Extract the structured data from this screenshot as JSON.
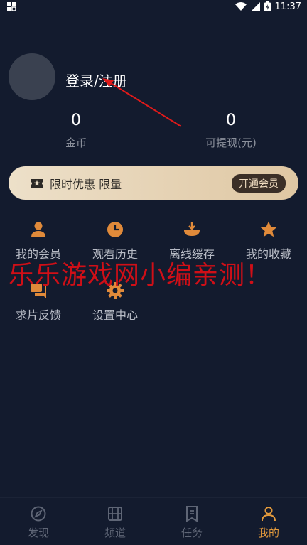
{
  "status_bar": {
    "time": "11:37"
  },
  "profile": {
    "login_text": "登录/注册"
  },
  "stats": [
    {
      "value": "0",
      "label": "金币"
    },
    {
      "value": "0",
      "label": "可提现(元)"
    }
  ],
  "vip_banner": {
    "text": "限时优惠 限量",
    "button_label": "开通会员"
  },
  "menu_items": [
    {
      "label": "我的会员",
      "icon": "user-icon"
    },
    {
      "label": "观看历史",
      "icon": "clock-icon"
    },
    {
      "label": "离线缓存",
      "icon": "download-icon"
    },
    {
      "label": "我的收藏",
      "icon": "star-icon"
    },
    {
      "label": "求片反馈",
      "icon": "chat-icon"
    },
    {
      "label": "设置中心",
      "icon": "gear-icon"
    }
  ],
  "watermark": "乐乐游戏网小编亲测！",
  "tabs": [
    {
      "label": "发现",
      "icon": "compass-icon",
      "active": false
    },
    {
      "label": "频道",
      "icon": "film-icon",
      "active": false
    },
    {
      "label": "任务",
      "icon": "task-list-icon",
      "active": false
    },
    {
      "label": "我的",
      "icon": "person-icon",
      "active": true
    }
  ],
  "colors": {
    "background": "#131b2e",
    "accent": "#e39a3c",
    "watermark": "#d00f17"
  }
}
